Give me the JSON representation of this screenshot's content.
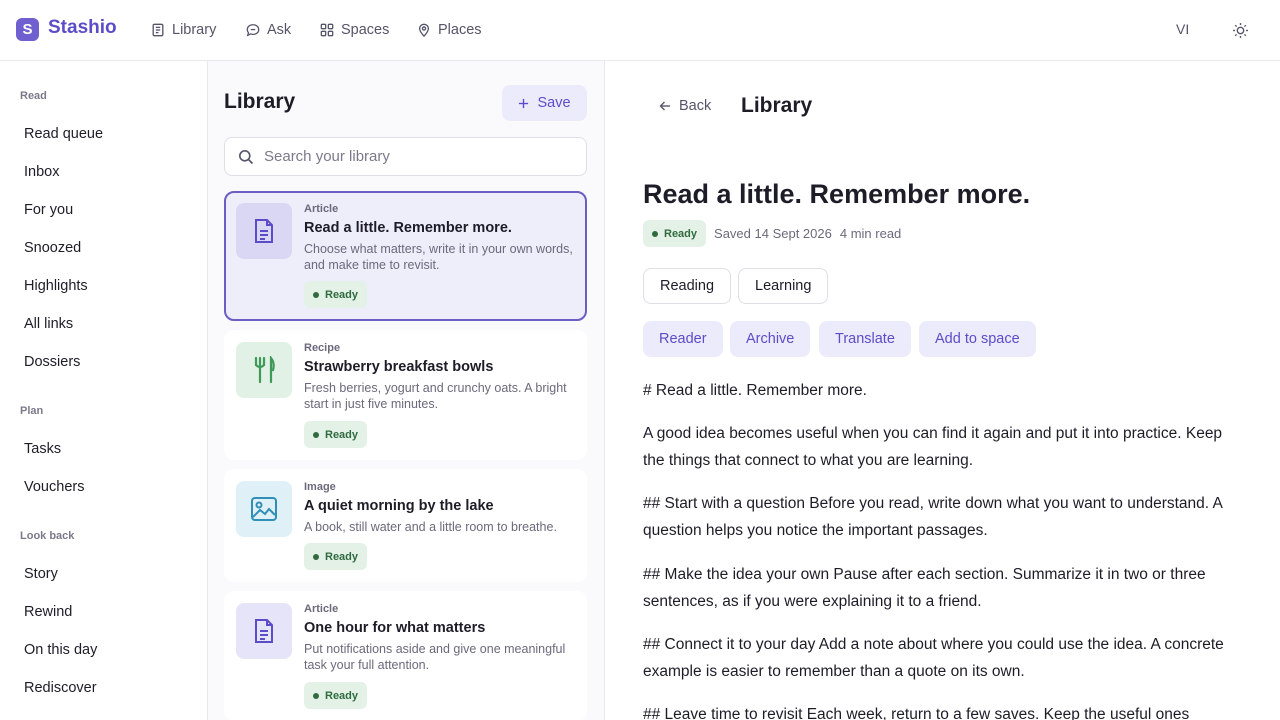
{
  "app": {
    "brand": "Stashio",
    "logo_letter": "S",
    "nav": [
      {
        "label": "Library",
        "icon": "book-icon"
      },
      {
        "label": "Ask",
        "icon": "chat-icon"
      },
      {
        "label": "Spaces",
        "icon": "grid-icon"
      },
      {
        "label": "Places",
        "icon": "pin-icon"
      }
    ],
    "user_initials": "VI",
    "theme_icon": "sun-icon"
  },
  "sidebar": {
    "sections": [
      {
        "title": "Read",
        "items": [
          "Read queue",
          "Inbox",
          "For you",
          "Snoozed",
          "Highlights",
          "All links",
          "Dossiers"
        ]
      },
      {
        "title": "Plan",
        "items": [
          "Tasks",
          "Vouchers"
        ]
      },
      {
        "title": "Look back",
        "items": [
          "Story",
          "Rewind",
          "On this day",
          "Rediscover"
        ]
      }
    ]
  },
  "library": {
    "title": "Library",
    "save_label": "Save",
    "search_placeholder": "Search your library",
    "search_value": "",
    "cards": [
      {
        "type": "Article",
        "title": "Read a little. Remember more.",
        "desc": "Choose what matters, write it in your own words, and make time to revisit.",
        "status": "Ready",
        "icon": "document-icon",
        "selected": true
      },
      {
        "type": "Recipe",
        "title": "Strawberry breakfast bowls",
        "desc": "Fresh berries, yogurt and crunchy oats. A bright start in just five minutes.",
        "status": "Ready",
        "icon": "utensils-icon",
        "selected": false
      },
      {
        "type": "Image",
        "title": "A quiet morning by the lake",
        "desc": "A book, still water and a little room to breathe.",
        "status": "Ready",
        "icon": "image-icon",
        "selected": false
      },
      {
        "type": "Article",
        "title": "One hour for what matters",
        "desc": "Put notifications aside and give one meaningful task your full attention.",
        "status": "Ready",
        "icon": "document-icon",
        "selected": false
      }
    ]
  },
  "reader": {
    "back_label": "Back",
    "heading": "Library",
    "title": "Read a little. Remember more.",
    "status": "Ready",
    "saved": "Saved 14 Sept 2026",
    "read_time": "4 min read",
    "tags": [
      "Reading",
      "Learning"
    ],
    "actions": [
      "Reader",
      "Archive",
      "Translate",
      "Add to space"
    ],
    "paragraphs": [
      "# Read a little. Remember more.",
      "A good idea becomes useful when you can find it again and put it into practice. Keep the things that connect to what you are learning.",
      "## Start with a question Before you read, write down what you want to understand. A question helps you notice the important passages.",
      "## Make the idea your own Pause after each section. Summarize it in two or three sentences, as if you were explaining it to a friend.",
      "## Connect it to your day Add a note about where you could use the idea. A concrete example is easier to remember than a quote on its own.",
      "## Leave time to revisit Each week, return to a few saves. Keep the useful ones"
    ]
  },
  "colors": {
    "accent": "#5b4dc8",
    "accent_soft": "#ecebfb",
    "ready_bg": "#e4f1e7",
    "ready_fg": "#2f6b3f"
  }
}
